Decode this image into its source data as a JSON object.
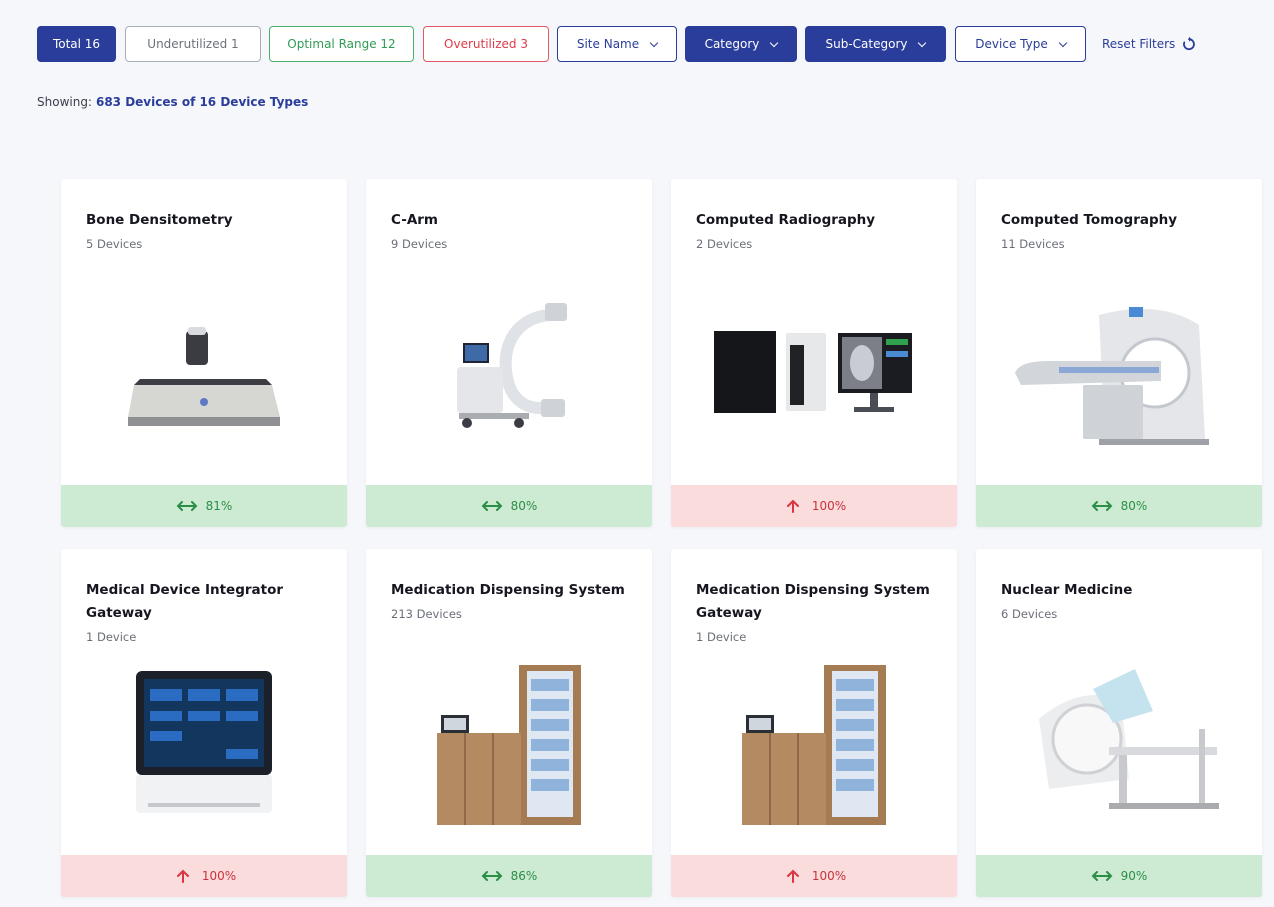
{
  "filters": {
    "total": "Total 16",
    "underutilized": "Underutilized 1",
    "optimal": "Optimal Range 12",
    "overutilized": "Overutilized 3",
    "site_name": "Site Name",
    "category": "Category",
    "sub_category": "Sub-Category",
    "device_type": "Device Type",
    "reset": "Reset Filters"
  },
  "summary": {
    "label": "Showing:",
    "value": "683 Devices of 16 Device Types"
  },
  "colors": {
    "brand": "#2a3d9a",
    "optimal": "#cdebd3",
    "over": "#fbdcdd"
  },
  "cards": [
    {
      "title": "Bone Densitometry",
      "devices": "5 Devices",
      "util": "81%",
      "status": "optimal",
      "icon": "bone-densitometer-image"
    },
    {
      "title": "C-Arm",
      "devices": "9 Devices",
      "util": "80%",
      "status": "optimal",
      "icon": "c-arm-image"
    },
    {
      "title": "Computed Radiography",
      "devices": "2 Devices",
      "util": "100%",
      "status": "over",
      "icon": "computed-radiography-image"
    },
    {
      "title": "Computed Tomography",
      "devices": "11 Devices",
      "util": "80%",
      "status": "optimal",
      "icon": "ct-scanner-image"
    },
    {
      "title": "Medical Device Integrator Gateway",
      "devices": "1 Device",
      "util": "100%",
      "status": "over",
      "icon": "gateway-tablet-image"
    },
    {
      "title": "Medication Dispensing System",
      "devices": "213 Devices",
      "util": "86%",
      "status": "optimal",
      "icon": "dispensing-cabinet-image"
    },
    {
      "title": "Medication Dispensing System Gateway",
      "devices": "1 Device",
      "util": "100%",
      "status": "over",
      "icon": "dispensing-cabinet-image"
    },
    {
      "title": "Nuclear Medicine",
      "devices": "6 Devices",
      "util": "90%",
      "status": "optimal",
      "icon": "nuclear-medicine-image"
    }
  ]
}
